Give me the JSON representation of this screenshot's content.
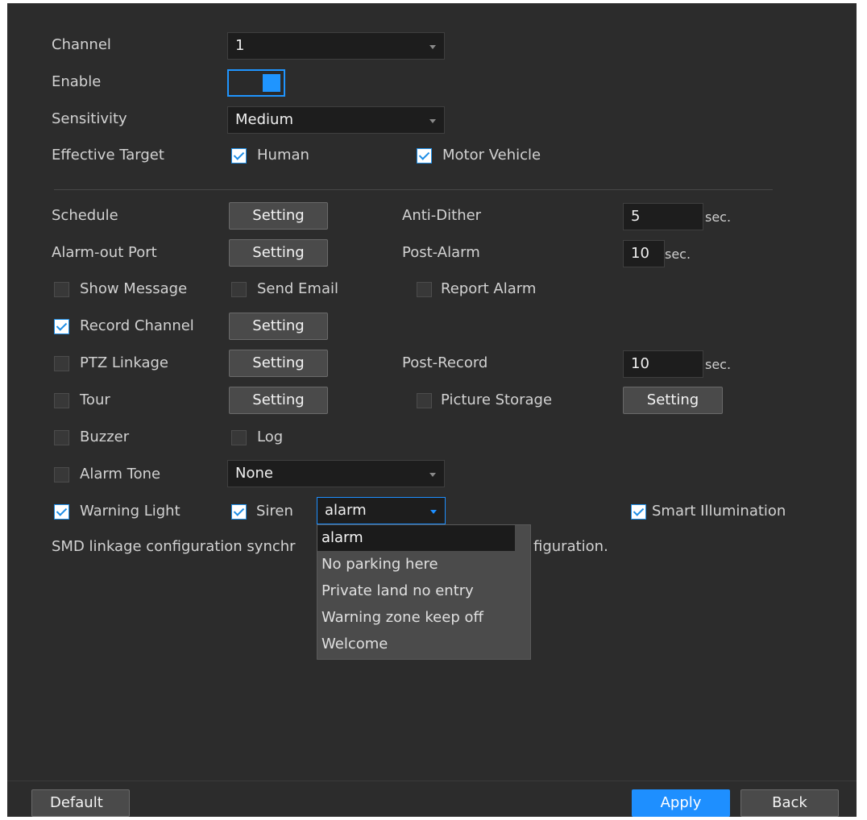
{
  "form": {
    "channel": {
      "label": "Channel",
      "value": "1"
    },
    "enable": {
      "label": "Enable",
      "on": true
    },
    "sensitivity": {
      "label": "Sensitivity",
      "value": "Medium"
    },
    "effective_target": {
      "label": "Effective Target",
      "human": {
        "label": "Human",
        "checked": true
      },
      "motor_vehicle": {
        "label": "Motor Vehicle",
        "checked": true
      }
    },
    "schedule": {
      "label": "Schedule",
      "button": "Setting"
    },
    "alarm_out_port": {
      "label": "Alarm-out Port",
      "button": "Setting"
    },
    "anti_dither": {
      "label": "Anti-Dither",
      "value": "5",
      "unit": "sec."
    },
    "post_alarm": {
      "label": "Post-Alarm",
      "value": "10",
      "unit": "sec."
    },
    "show_message": {
      "label": "Show Message",
      "checked": false
    },
    "send_email": {
      "label": "Send Email",
      "checked": false
    },
    "report_alarm": {
      "label": "Report Alarm",
      "checked": false
    },
    "record_channel": {
      "label": "Record Channel",
      "checked": true,
      "button": "Setting"
    },
    "ptz_linkage": {
      "label": "PTZ Linkage",
      "checked": false,
      "button": "Setting"
    },
    "post_record": {
      "label": "Post-Record",
      "value": "10",
      "unit": "sec."
    },
    "tour": {
      "label": "Tour",
      "checked": false,
      "button": "Setting"
    },
    "picture_storage": {
      "label": "Picture Storage",
      "checked": false,
      "button": "Setting"
    },
    "buzzer": {
      "label": "Buzzer",
      "checked": false
    },
    "log": {
      "label": "Log",
      "checked": false
    },
    "alarm_tone": {
      "label": "Alarm Tone",
      "checked": false,
      "value": "None"
    },
    "warning_light": {
      "label": "Warning Light",
      "checked": true
    },
    "siren": {
      "label": "Siren",
      "checked": true,
      "value": "alarm"
    },
    "smart_illumination": {
      "label": "Smart Illumination",
      "checked": true
    },
    "note_left": "SMD linkage configuration synchr",
    "note_right": "figuration."
  },
  "siren_dropdown": {
    "options": [
      "alarm",
      "No parking here",
      "Private land no entry",
      "Warning zone keep off",
      "Welcome"
    ],
    "selected_index": 0
  },
  "footer": {
    "default": "Default",
    "apply": "Apply",
    "back": "Back"
  },
  "colors": {
    "accent": "#1e8fff",
    "background": "#2c2c2c"
  },
  "icons": {
    "dropdown": "caret-down-icon",
    "checkbox": "checkmark-icon"
  }
}
